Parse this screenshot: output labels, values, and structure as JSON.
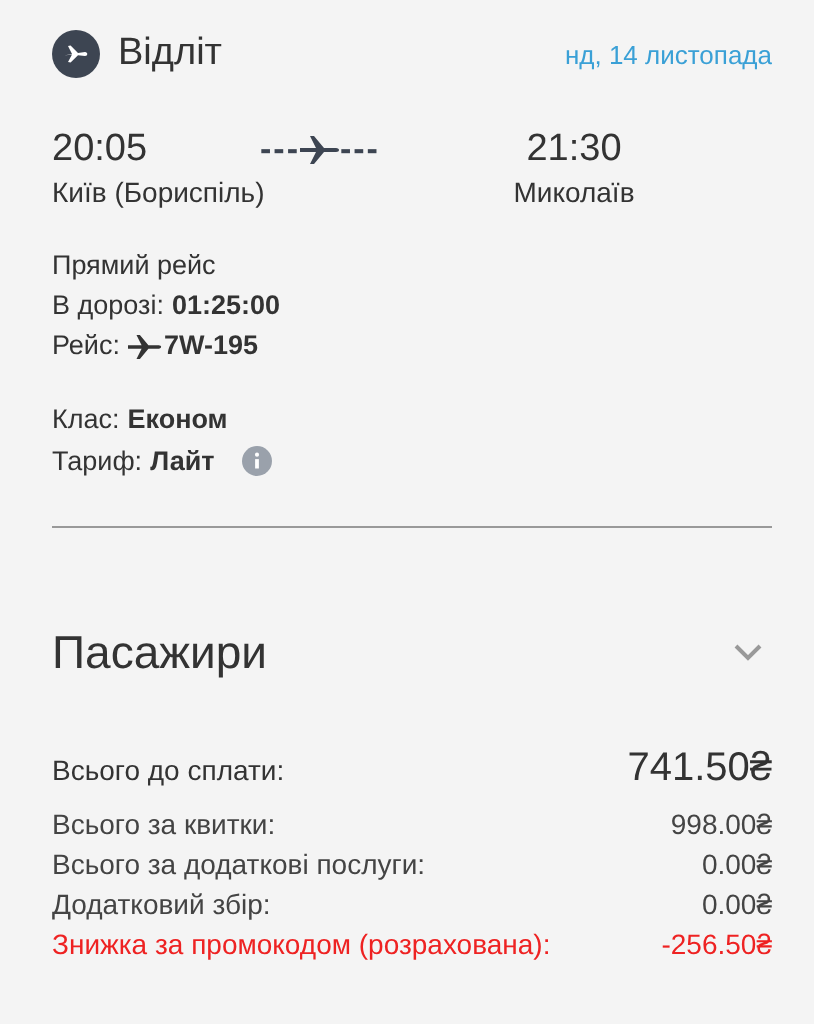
{
  "direction": {
    "title": "Відліт",
    "date": "нд, 14 листопада"
  },
  "route": {
    "departure": {
      "time": "20:05",
      "city": "Київ (Бориспіль)"
    },
    "arrival": {
      "time": "21:30",
      "city": "Миколаїв"
    },
    "dashes_left": "---",
    "dashes_right": "---"
  },
  "details": [
    {
      "kind": "text",
      "text": "Прямий рейс"
    },
    {
      "kind": "pair",
      "label": "В дорозі:",
      "value": "01:25:00"
    },
    {
      "kind": "flight",
      "label": "Рейс:",
      "value": "7W-195"
    }
  ],
  "fare": [
    {
      "kind": "pair",
      "label": "Клас:",
      "value": "Економ"
    },
    {
      "kind": "info",
      "label": "Тариф:",
      "value": "Лайт"
    }
  ],
  "passengers": {
    "title": "Пасажири",
    "expanded": false
  },
  "total": {
    "label": "Всього до сплати:",
    "amount": "741.50₴"
  },
  "price_rows": [
    {
      "kind": "normal",
      "label": "Всього за квитки:",
      "amount": "998.00₴"
    },
    {
      "kind": "normal",
      "label": "Всього за додаткові послуги:",
      "amount": "0.00₴"
    },
    {
      "kind": "normal",
      "label": "Додатковий збір:",
      "amount": "0.00₴"
    },
    {
      "kind": "discount",
      "label": "Знижка за промокодом (розрахована):",
      "amount": "-256.50₴"
    }
  ]
}
